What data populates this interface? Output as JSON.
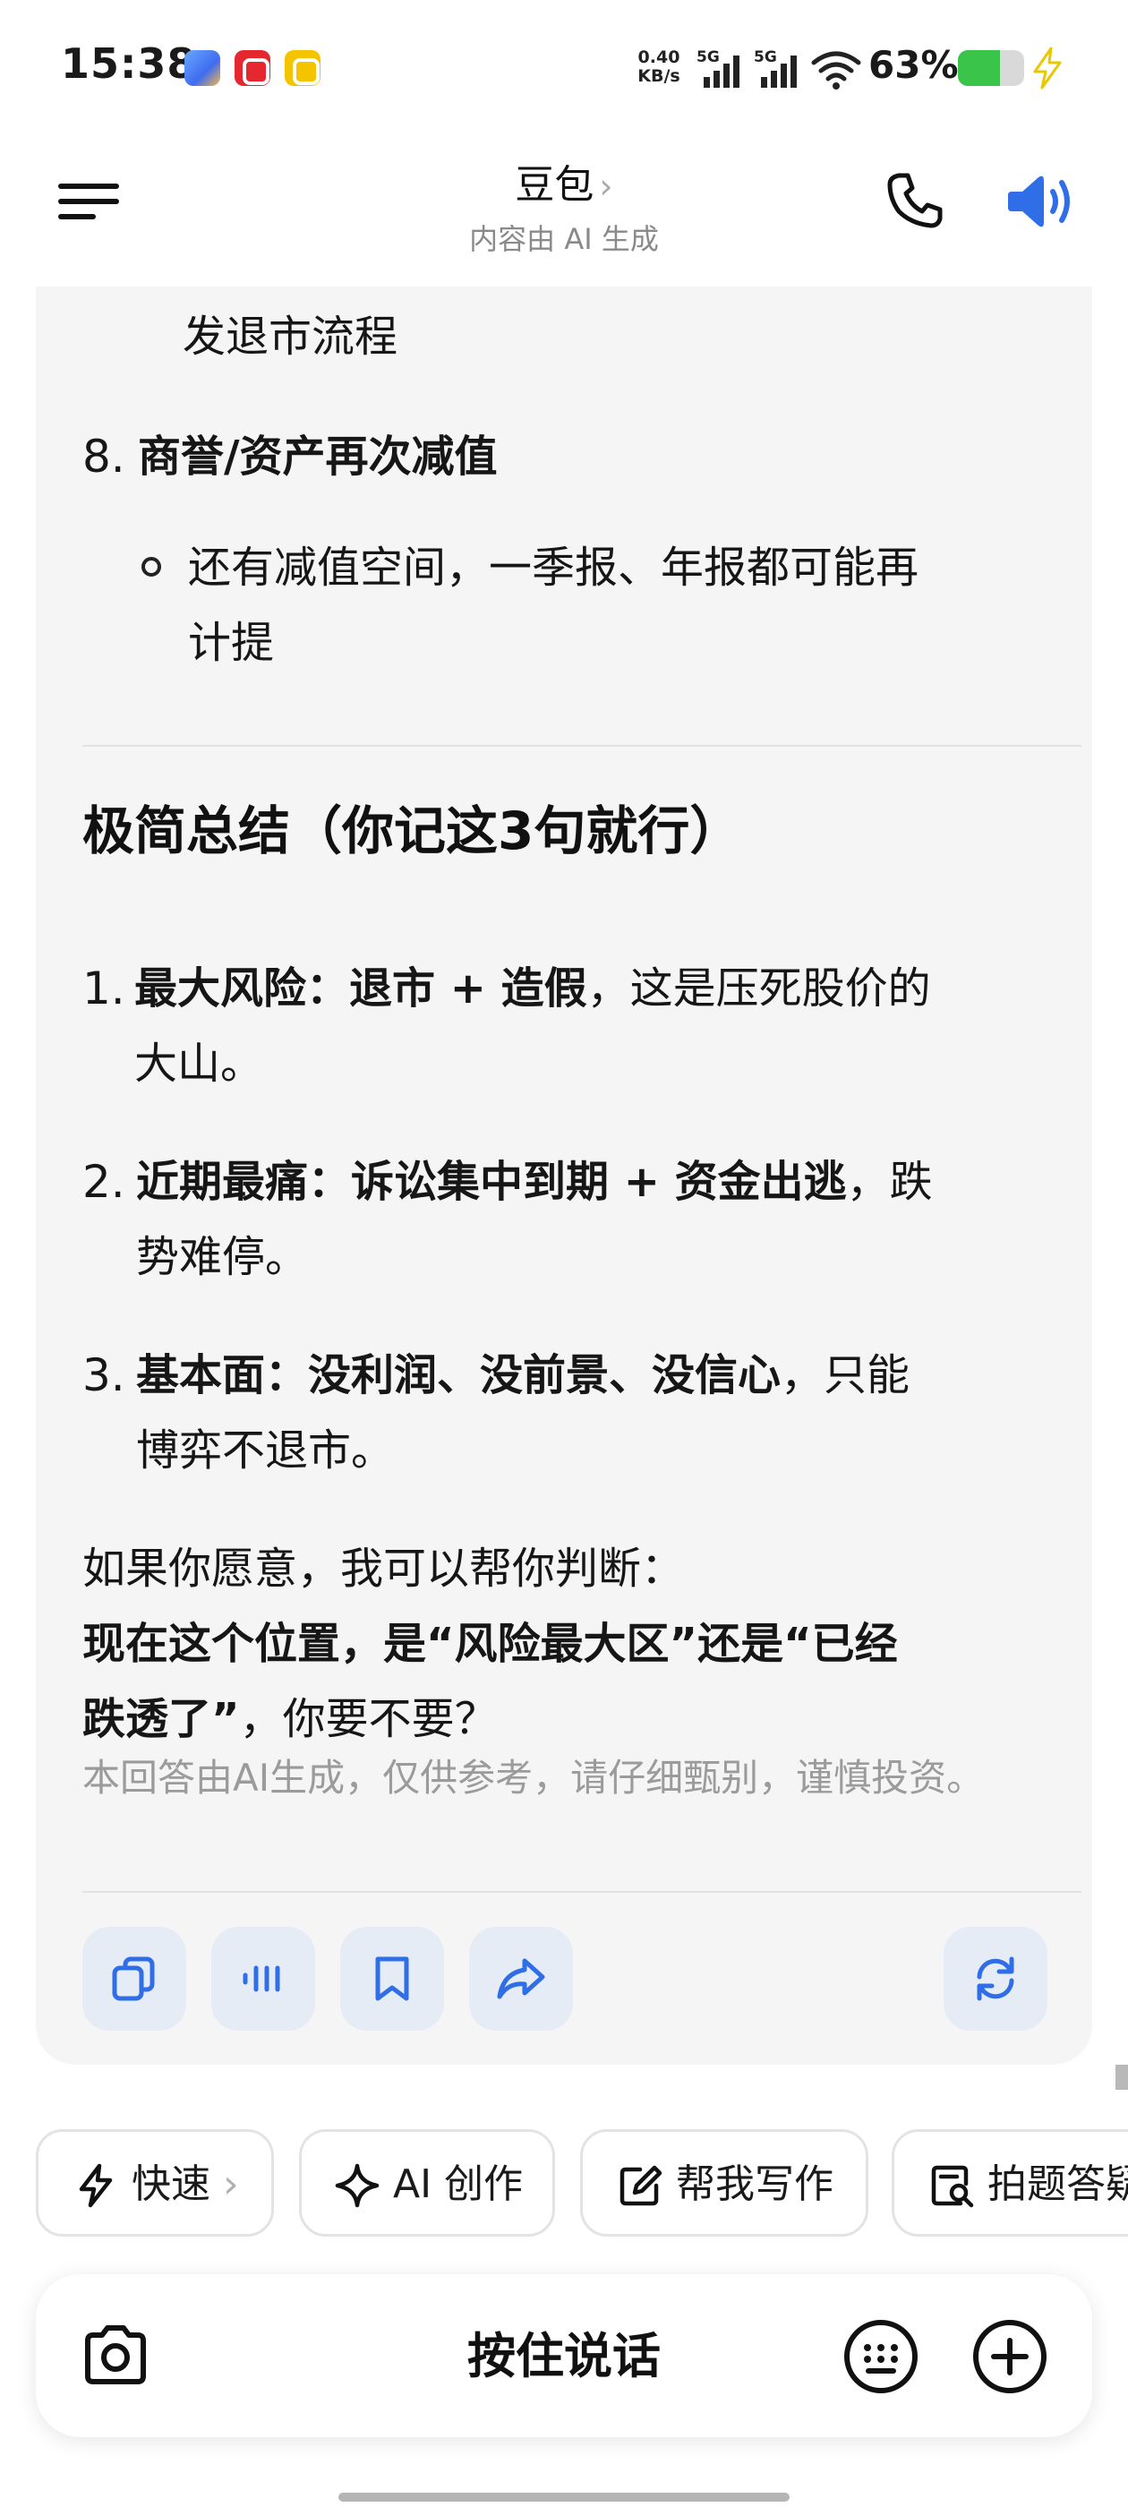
{
  "status_bar": {
    "time": "15:38",
    "net_speed_value": "0.40",
    "net_speed_unit": "KB/s",
    "signal_1_label": "5G",
    "signal_2_label": "5G",
    "battery_percent": "63%",
    "battery_level": 0.63,
    "battery_color": "#3ac44a"
  },
  "header": {
    "title": "豆包",
    "title_chevron": "›",
    "subtitle": "内容由 AI 生成"
  },
  "content": {
    "item7_tail": "发退市流程",
    "item8_number": "8.",
    "item8_title": "商誉/资产再次减值",
    "item8_bullet_line1": "还有减值空间，一季报、年报都可能再",
    "item8_bullet_line2": "计提",
    "summary_heading": "极简总结（你记这3句就行）",
    "summary": [
      {
        "number": "1.",
        "bold": "最大风险：退市 + 造假",
        "rest_line1": "，这是压死股价的",
        "line2": "大山。"
      },
      {
        "number": "2.",
        "bold": "近期最痛：诉讼集中到期 + 资金出逃",
        "rest_line1": "，跌",
        "line2": "势难停。"
      },
      {
        "number": "3.",
        "bold": "基本面：没利润、没前景、没信心",
        "rest_line1": "，只能",
        "line2": "博弈不退市。"
      }
    ],
    "offer_line1": "如果你愿意，我可以帮你判断：",
    "offer_line2_bold": "现在这个位置，是“风险最大区”还是“已经",
    "offer_line3_bold": "跌透了”",
    "offer_line3_rest": "，你要不要？",
    "disclaimer": "本回答由AI生成，仅供参考，请仔细甄别，谨慎投资。"
  },
  "actions": {
    "icons": [
      "copy-icon",
      "voice-play-icon",
      "bookmark-icon",
      "share-icon",
      "regenerate-icon"
    ],
    "accent_color": "#2f6ee6"
  },
  "chips": [
    {
      "label": "快速",
      "icon": "lightning-icon",
      "chevron": "›"
    },
    {
      "label": "AI 创作",
      "icon": "sparkle-icon"
    },
    {
      "label": "帮我写作",
      "icon": "edit-icon"
    },
    {
      "label": "拍题答疑",
      "icon": "scan-question-icon"
    }
  ],
  "input_bar": {
    "hold_to_talk": "按住说话"
  }
}
